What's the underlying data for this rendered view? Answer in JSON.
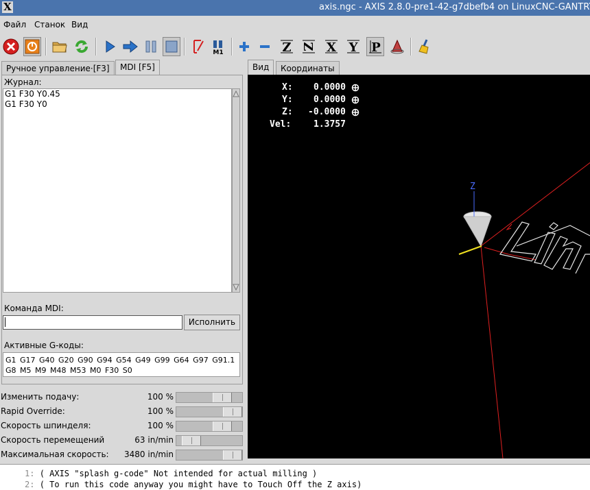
{
  "window": {
    "title": "axis.ngc - AXIS 2.8.0-pre1-42-g7dbefb4 on LinuxCNC-GANTRY"
  },
  "menu": [
    "Файл",
    "Станок",
    "Вид"
  ],
  "tabs_left": [
    "Ручное управление·[F3]",
    "MDI [F5]"
  ],
  "tabs_right": [
    "Вид",
    "Координаты"
  ],
  "mdi": {
    "journal_label": "Журнал:",
    "journal_lines": [
      "G1 F30 Y0.45",
      "G1 F30 Y0"
    ],
    "command_label": "Команда MDI:",
    "command_value": "",
    "run_label": "Исполнить",
    "active_label": "Активные G-коды:",
    "active_line1": "G1 G17 G40 G20 G90 G94 G54 G49 G99 G64 G97 G91.1",
    "active_line2": "G8 M5 M9 M48 M53 M0 F30 S0"
  },
  "sliders": [
    {
      "name": "Изменить подачу:",
      "value": "100 %",
      "fraction": 0.78
    },
    {
      "name": "Rapid Override:",
      "value": "100 %",
      "fraction": 1.0
    },
    {
      "name": "Скорость шпинделя:",
      "value": "100 %",
      "fraction": 0.78
    },
    {
      "name": "Скорость перемещений",
      "value": "63 in/min",
      "fraction": 0.12
    },
    {
      "name": "Максимальная скорость:",
      "value": "3480 in/min",
      "fraction": 1.0
    }
  ],
  "dro": {
    "x_label": "X:",
    "x": "0.0000",
    "y_label": "Y:",
    "y": "0.0000",
    "z_label": "Z:",
    "z": "-0.0000",
    "vel_label": "Vel:",
    "vel": "1.3757",
    "axis_z_label": "Z"
  },
  "code": [
    {
      "num": "1:",
      "text": "( AXIS \"splash g-code\" Not intended for actual milling )"
    },
    {
      "num": "2:",
      "text": "( To run this code anyway you might have to Touch Off the Z axis)"
    }
  ],
  "colors": {
    "titlebar": "#4a74ad",
    "estop": "#d42020",
    "tool_orange": "#e8801a",
    "play_blue": "#2a72c8",
    "reload_green": "#3aa832",
    "path_red": "#e02020",
    "axis_z_blue": "#4a6cff",
    "axis_x_yellow": "#f0e020"
  }
}
